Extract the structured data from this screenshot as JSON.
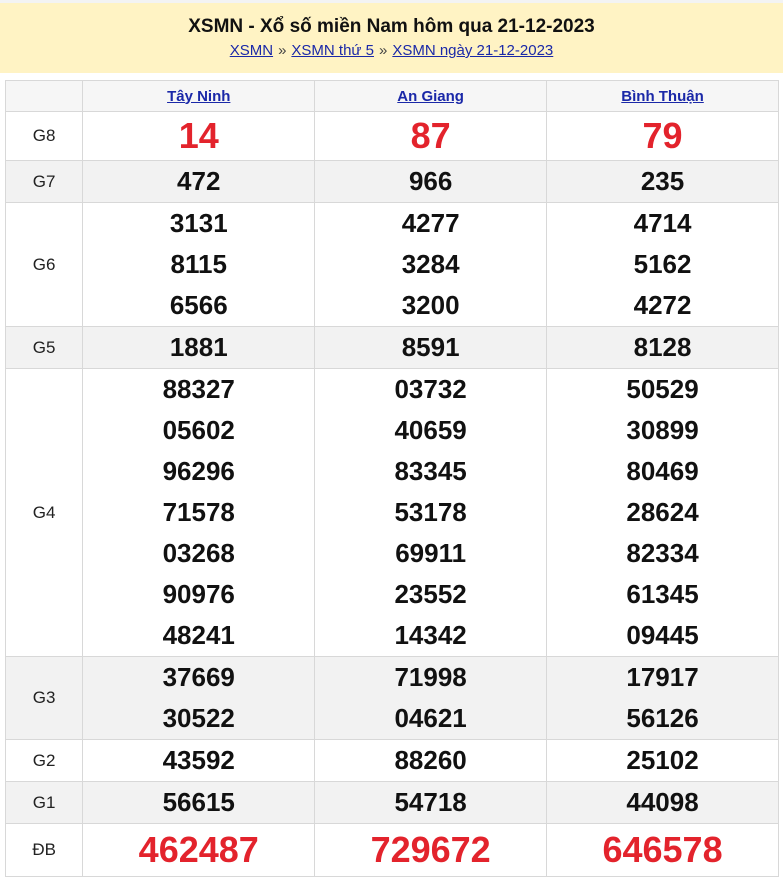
{
  "header": {
    "title": "XSMN - Xổ số miền Nam hôm qua 21-12-2023",
    "crumbs": [
      "XSMN",
      "XSMN thứ 5",
      "XSMN ngày 21-12-2023"
    ],
    "separator": "»"
  },
  "provinces": [
    "Tây Ninh",
    "An Giang",
    "Bình Thuận"
  ],
  "prizes": [
    {
      "label": "G8",
      "style": "red",
      "values": [
        [
          "14"
        ],
        [
          "87"
        ],
        [
          "79"
        ]
      ]
    },
    {
      "label": "G7",
      "values": [
        [
          "472"
        ],
        [
          "966"
        ],
        [
          "235"
        ]
      ]
    },
    {
      "label": "G6",
      "values": [
        [
          "3131",
          "8115",
          "6566"
        ],
        [
          "4277",
          "3284",
          "3200"
        ],
        [
          "4714",
          "5162",
          "4272"
        ]
      ]
    },
    {
      "label": "G5",
      "values": [
        [
          "1881"
        ],
        [
          "8591"
        ],
        [
          "8128"
        ]
      ]
    },
    {
      "label": "G4",
      "values": [
        [
          "88327",
          "05602",
          "96296",
          "71578",
          "03268",
          "90976",
          "48241"
        ],
        [
          "03732",
          "40659",
          "83345",
          "53178",
          "69911",
          "23552",
          "14342"
        ],
        [
          "50529",
          "30899",
          "80469",
          "28624",
          "82334",
          "61345",
          "09445"
        ]
      ]
    },
    {
      "label": "G3",
      "values": [
        [
          "37669",
          "30522"
        ],
        [
          "71998",
          "04621"
        ],
        [
          "17917",
          "56126"
        ]
      ]
    },
    {
      "label": "G2",
      "values": [
        [
          "43592"
        ],
        [
          "88260"
        ],
        [
          "25102"
        ]
      ]
    },
    {
      "label": "G1",
      "values": [
        [
          "56615"
        ],
        [
          "54718"
        ],
        [
          "44098"
        ]
      ]
    },
    {
      "label": "ĐB",
      "style": "special",
      "values": [
        [
          "462487"
        ],
        [
          "729672"
        ],
        [
          "646578"
        ]
      ]
    }
  ],
  "colors": {
    "header_bg": "#fff3c4",
    "link": "#1a28a8",
    "highlight_red": "#e3232c",
    "row_shade": "#f2f2f2"
  }
}
